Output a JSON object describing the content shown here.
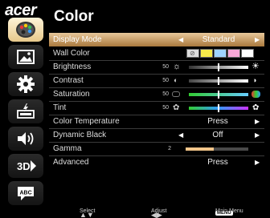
{
  "brand": {
    "logo_text": "acer"
  },
  "header": {
    "title": "Color"
  },
  "sidebar": {
    "items": [
      {
        "icon": "palette-icon",
        "active": true
      },
      {
        "icon": "picture-icon",
        "active": false
      },
      {
        "icon": "gear-icon",
        "active": false
      },
      {
        "icon": "input-source-icon",
        "active": false
      },
      {
        "icon": "speaker-icon",
        "active": false
      },
      {
        "icon": "3d-icon",
        "active": false
      },
      {
        "icon": "language-icon",
        "label": "ABC",
        "active": false
      }
    ]
  },
  "menu": {
    "display_mode": {
      "label": "Display Mode",
      "value": "Standard"
    },
    "wall_color": {
      "label": "Wall Color",
      "swatches": [
        "#dcdcdc",
        "#f6e94a",
        "#9fd4ff",
        "#f7a7d6",
        "#ffffff"
      ]
    },
    "brightness": {
      "label": "Brightness",
      "value": "50",
      "level": 0.5
    },
    "contrast": {
      "label": "Contrast",
      "value": "50",
      "level": 0.5
    },
    "saturation": {
      "label": "Saturation",
      "value": "50",
      "level": 0.5
    },
    "tint": {
      "label": "Tint",
      "value": "50",
      "level": 0.5
    },
    "color_temperature": {
      "label": "Color Temperature",
      "value": "Press"
    },
    "dynamic_black": {
      "label": "Dynamic Black",
      "value": "Off"
    },
    "gamma": {
      "label": "Gamma",
      "value": "2",
      "level": 0.45
    },
    "advanced": {
      "label": "Advanced",
      "value": "Press"
    }
  },
  "footer": {
    "select": "Select",
    "adjust": "Adjust",
    "menu_key": "MENU",
    "main_menu": "Main Menu"
  },
  "colors": {
    "selected_row": "#c49a5c",
    "gamma_fill": "#f2c58a"
  }
}
